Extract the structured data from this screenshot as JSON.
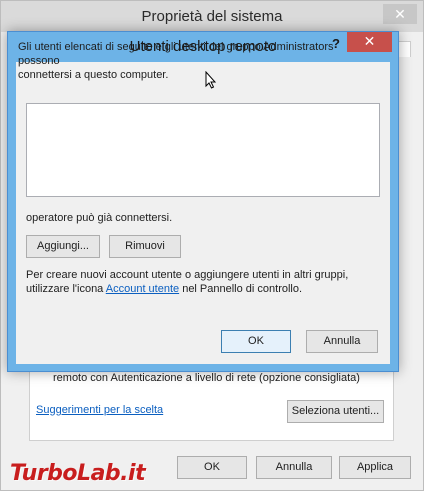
{
  "background_window": {
    "title": "Proprietà del sistema",
    "close_glyph": "✕",
    "checkbox_text": "remoto con Autenticazione a livello di rete (opzione consigliata)",
    "help_link": "Suggerimenti per la scelta",
    "select_users_button": "Seleziona utenti...",
    "ok_button": "OK",
    "cancel_button": "Annulla",
    "apply_button": "Applica"
  },
  "dialog": {
    "title": "Utenti desktop remoto",
    "help_glyph": "?",
    "close_glyph": "✕",
    "intro_line1": "Gli utenti elencati di seguito e gli utenti del gruppo Administrators possono",
    "intro_line2": "connettersi a questo computer.",
    "note": "operatore può già connettersi.",
    "add_button": "Aggiungi...",
    "remove_button": "Rimuovi",
    "info_line1": "Per creare nuovi account utente o aggiungere utenti in altri gruppi,",
    "info_prefix": "utilizzare l'icona ",
    "info_link": "Account utente",
    "info_suffix": " nel Pannello di controllo.",
    "ok_button": "OK",
    "cancel_button": "Annulla"
  },
  "watermark": {
    "brand_main": "TurboLab",
    "brand_tld": ".it"
  },
  "colors": {
    "dialog_frame": "#6db3e7",
    "close_button": "#c7504b",
    "link": "#0b5fc0",
    "watermark": "#c81e1e"
  }
}
